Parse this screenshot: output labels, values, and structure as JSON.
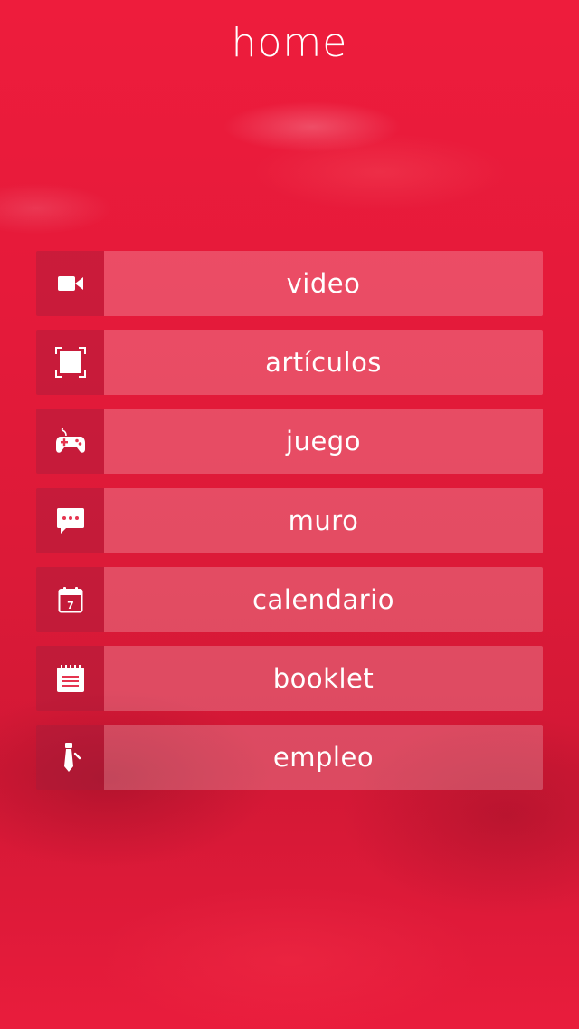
{
  "header": {
    "title": "home"
  },
  "menu": {
    "items": [
      {
        "label": "video",
        "icon": "video-camera-icon"
      },
      {
        "label": "artículos",
        "icon": "article-frame-icon"
      },
      {
        "label": "juego",
        "icon": "gamepad-icon"
      },
      {
        "label": "muro",
        "icon": "chat-bubble-icon"
      },
      {
        "label": "calendario",
        "icon": "calendar-icon",
        "icon_text": "7"
      },
      {
        "label": "booklet",
        "icon": "notepad-icon"
      },
      {
        "label": "empleo",
        "icon": "necktie-icon"
      }
    ]
  },
  "colors": {
    "background": "#e91a3b",
    "text": "#ffffff"
  }
}
